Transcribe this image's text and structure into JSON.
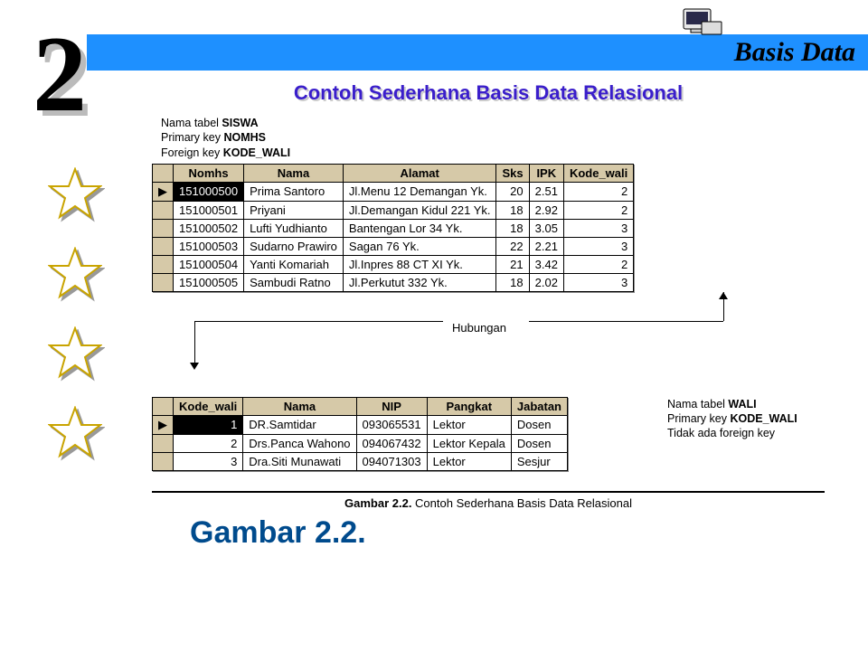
{
  "header": {
    "brand": "Basis Data"
  },
  "chapter_number": "2",
  "title": "Contoh Sederhana Basis Data Relasional",
  "siswa_meta": {
    "line1a": "Nama tabel ",
    "line1b": "SISWA",
    "line2a": "Primary key ",
    "line2b": "NOMHS",
    "line3a": "Foreign key ",
    "line3b": "KODE_WALI"
  },
  "siswa": {
    "headers": [
      "Nomhs",
      "Nama",
      "Alamat",
      "Sks",
      "IPK",
      "Kode_wali"
    ],
    "rows": [
      {
        "nomhs": "151000500",
        "nama": "Prima Santoro",
        "alamat": "Jl.Menu 12 Demangan Yk.",
        "sks": "20",
        "ipk": "2.51",
        "kode": "2",
        "sel": true
      },
      {
        "nomhs": "151000501",
        "nama": "Priyani",
        "alamat": "Jl.Demangan Kidul 221 Yk.",
        "sks": "18",
        "ipk": "2.92",
        "kode": "2"
      },
      {
        "nomhs": "151000502",
        "nama": "Lufti Yudhianto",
        "alamat": "Bantengan Lor 34 Yk.",
        "sks": "18",
        "ipk": "3.05",
        "kode": "3"
      },
      {
        "nomhs": "151000503",
        "nama": "Sudarno Prawiro",
        "alamat": "Sagan 76 Yk.",
        "sks": "22",
        "ipk": "2.21",
        "kode": "3"
      },
      {
        "nomhs": "151000504",
        "nama": "Yanti Komariah",
        "alamat": "Jl.Inpres 88 CT XI Yk.",
        "sks": "21",
        "ipk": "3.42",
        "kode": "2"
      },
      {
        "nomhs": "151000505",
        "nama": "Sambudi Ratno",
        "alamat": "Jl.Perkutut 332 Yk.",
        "sks": "18",
        "ipk": "2.02",
        "kode": "3"
      }
    ]
  },
  "relation_label": "Hubungan",
  "wali_meta": {
    "line1a": "Nama tabel ",
    "line1b": "WALI",
    "line2a": "Primary key ",
    "line2b": "KODE_WALI",
    "line3": "Tidak ada foreign key"
  },
  "wali": {
    "headers": [
      "Kode_wali",
      "Nama",
      "NIP",
      "Pangkat",
      "Jabatan"
    ],
    "rows": [
      {
        "kode": "1",
        "nama": "DR.Samtidar",
        "nip": "093065531",
        "pangkat": "Lektor",
        "jabatan": "Dosen",
        "sel": true
      },
      {
        "kode": "2",
        "nama": "Drs.Panca Wahono",
        "nip": "094067432",
        "pangkat": "Lektor Kepala",
        "jabatan": "Dosen"
      },
      {
        "kode": "3",
        "nama": "Dra.Siti Munawati",
        "nip": "094071303",
        "pangkat": "Lektor",
        "jabatan": "Sesjur"
      }
    ]
  },
  "caption_strong": "Gambar 2.2. ",
  "caption_rest": "Contoh Sederhana Basis Data Relasional",
  "big_caption": "Gambar 2.2."
}
